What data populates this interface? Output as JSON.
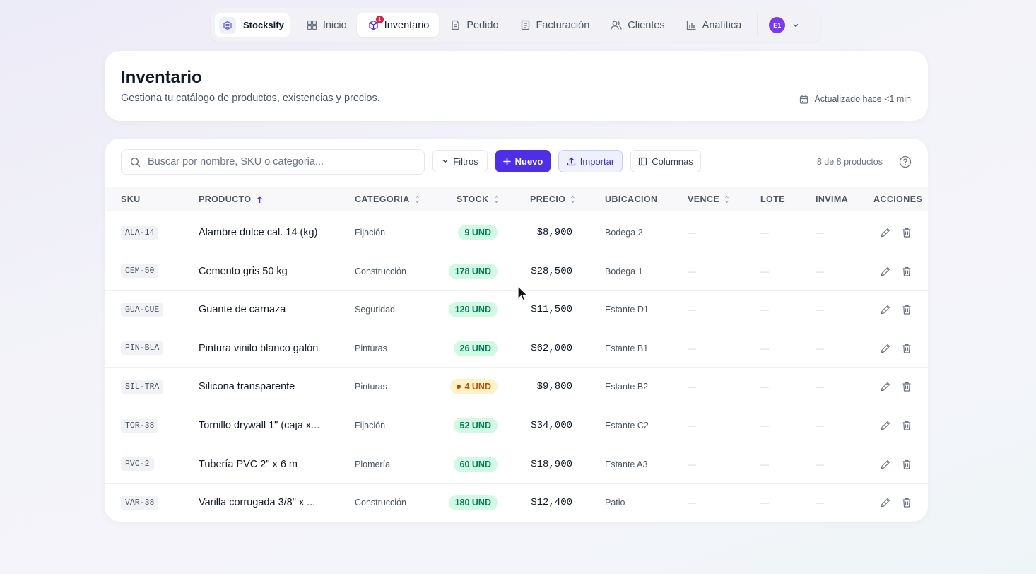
{
  "nav": {
    "brand": "Stocksify",
    "items": [
      {
        "label": "Inicio",
        "icon": "grid-icon"
      },
      {
        "label": "Inventario",
        "icon": "box-icon",
        "badge": "1",
        "active": true
      },
      {
        "label": "Pedido",
        "icon": "document-icon"
      },
      {
        "label": "Facturación",
        "icon": "invoice-icon"
      },
      {
        "label": "Clientes",
        "icon": "users-icon"
      },
      {
        "label": "Analítica",
        "icon": "bar-chart-icon"
      }
    ],
    "avatar": "E1"
  },
  "header": {
    "title": "Inventario",
    "subtitle": "Gestiona tu catálogo de productos, existencias y precios.",
    "updated": "Actualizado hace <1 min"
  },
  "toolbar": {
    "search_placeholder": "Buscar por nombre, SKU o categoria...",
    "filters": "Filtros",
    "new": "Nuevo",
    "import": "Importar",
    "columns": "Columnas",
    "count": "8 de 8 productos"
  },
  "table": {
    "headers": {
      "sku": "SKU",
      "product": "PRODUCTO",
      "category": "CATEGORIA",
      "stock": "STOCK",
      "price": "PRECIO",
      "location": "UBICACION",
      "expires": "VENCE",
      "lot": "LOTE",
      "invima": "INVIMA",
      "actions": "ACCIONES"
    },
    "empty": "—",
    "rows": [
      {
        "sku": "ALA-14",
        "product": "Alambre dulce cal. 14 (kg)",
        "category": "Fijación",
        "stock": "9 UND",
        "price": "$8,900",
        "location": "Bodega 2",
        "status": "ok"
      },
      {
        "sku": "CEM-50",
        "product": "Cemento gris 50 kg",
        "category": "Construcción",
        "stock": "178 UND",
        "price": "$28,500",
        "location": "Bodega 1",
        "status": "ok"
      },
      {
        "sku": "GUA-CUE",
        "product": "Guante de carnaza",
        "category": "Seguridad",
        "stock": "120 UND",
        "price": "$11,500",
        "location": "Estante D1",
        "status": "ok"
      },
      {
        "sku": "PIN-BLA",
        "product": "Pintura vinilo blanco galón",
        "category": "Pinturas",
        "stock": "26 UND",
        "price": "$62,000",
        "location": "Estante B1",
        "status": "ok"
      },
      {
        "sku": "SIL-TRA",
        "product": "Silicona transparente",
        "category": "Pinturas",
        "stock": "4 UND",
        "price": "$9,800",
        "location": "Estante B2",
        "status": "low"
      },
      {
        "sku": "TOR-38",
        "product": "Tornillo drywall 1\" (caja x...",
        "category": "Fijación",
        "stock": "52 UND",
        "price": "$34,000",
        "location": "Estante C2",
        "status": "ok"
      },
      {
        "sku": "PVC-2",
        "product": "Tubería PVC 2\" x 6 m",
        "category": "Plomería",
        "stock": "60 UND",
        "price": "$18,900",
        "location": "Estante A3",
        "status": "ok"
      },
      {
        "sku": "VAR-38",
        "product": "Varilla corrugada 3/8\" x ...",
        "category": "Construcción",
        "stock": "180 UND",
        "price": "$12,400",
        "location": "Patio",
        "status": "ok"
      }
    ]
  },
  "colors": {
    "accent": "#4f2fe6",
    "stock_ok_bg": "#d1fae5",
    "stock_low_bg": "#fef3c7",
    "badge": "#e11d48"
  }
}
